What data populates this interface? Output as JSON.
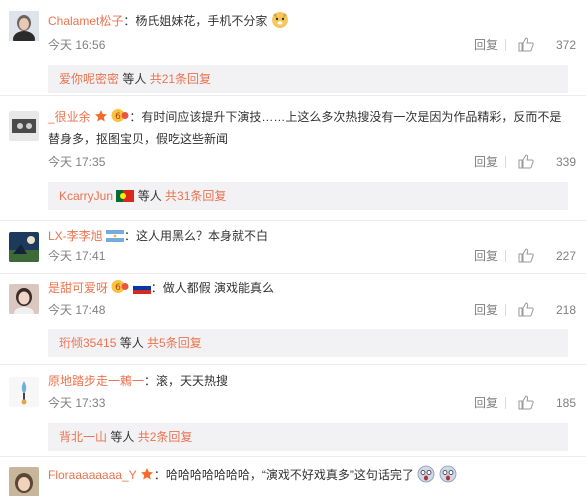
{
  "comments": [
    {
      "user": "Chalamet松子",
      "colon": "：",
      "text": "杨氏姐妹花，手机不分家",
      "time": "今天 16:56",
      "reply": "回复",
      "likes": "372",
      "sub": {
        "user": "爱你呢密密",
        "etc": " 等人 ",
        "more": "共21条回复"
      }
    },
    {
      "user": "_很业余",
      "colon": "：",
      "text": "有时间应该提升下演技……上这么多次热搜没有一次是因为作品精彩，反而不是",
      "text2": "替身多，抠图宝贝，假吃这些新闻",
      "time": "今天 17:35",
      "reply": "回复",
      "likes": "339",
      "sub": {
        "user": "KcarryJun",
        "etc": " 等人 ",
        "more": "共31条回复"
      }
    },
    {
      "user": "LX-李李旭",
      "colon": "：",
      "text": "这人用黑么？本身就不白",
      "time": "今天 17:41",
      "reply": "回复",
      "likes": "227"
    },
    {
      "user": "是甜可爱呀",
      "colon": "：",
      "text": "做人都假 演戏能真么",
      "time": "今天 17:48",
      "reply": "回复",
      "likes": "218",
      "sub": {
        "user": "珩倾35415",
        "etc": " 等人 ",
        "more": "共5条回复"
      }
    },
    {
      "user": "原地踏步走一鵣一",
      "colon": "：",
      "text": "滚，天天热搜",
      "time": "今天 17:33",
      "reply": "回复",
      "likes": "185",
      "sub": {
        "user": "背北一山",
        "etc": " 等人 ",
        "more": "共2条回复"
      }
    },
    {
      "user": "Floraaaaaaaa_Y",
      "colon": "：",
      "text": "哈哈哈哈哈哈哈，“演戏不好戏真多”这句话完了"
    }
  ],
  "colors": {
    "username": "#eb7350",
    "meta": "#808080",
    "subbox_bg": "#f2f2f5"
  }
}
